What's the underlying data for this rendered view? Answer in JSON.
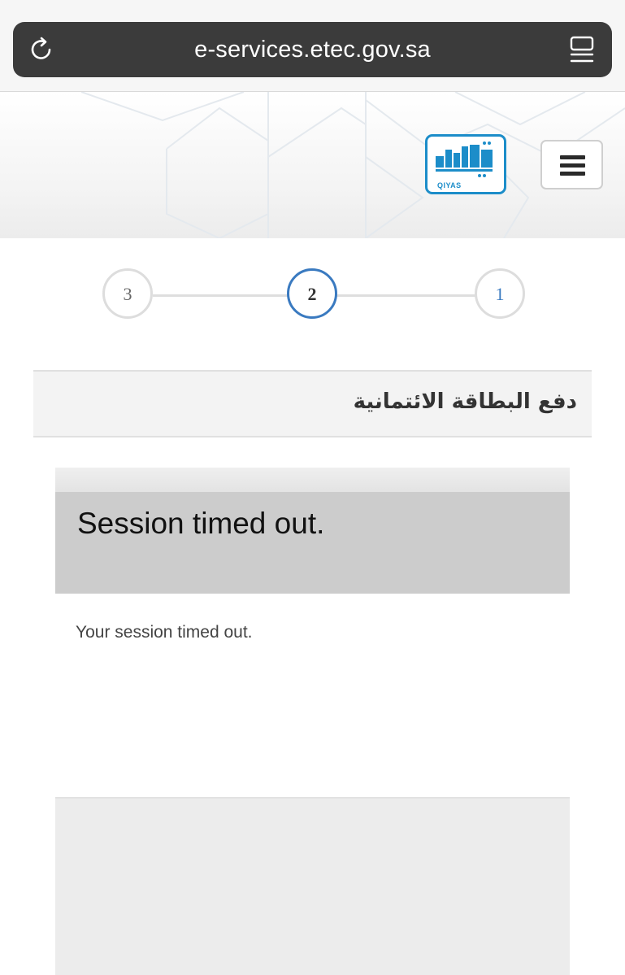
{
  "browser": {
    "url": "e-services.etec.gov.sa",
    "reload_icon": "reload-icon",
    "reader_icon": "reader-mode-icon"
  },
  "header": {
    "logo_text": "QIYAS",
    "logo_color": "#1c8dc9",
    "menu_icon": "hamburger-menu-icon"
  },
  "stepper": {
    "steps": [
      {
        "label": "3",
        "state": "inactive"
      },
      {
        "label": "2",
        "state": "active"
      },
      {
        "label": "1",
        "state": "completed"
      }
    ],
    "active_color": "#3a7ac0"
  },
  "section": {
    "title": "دفع البطاقة الائتمانية"
  },
  "session": {
    "title": "Session timed out.",
    "message": "Your session timed out."
  }
}
